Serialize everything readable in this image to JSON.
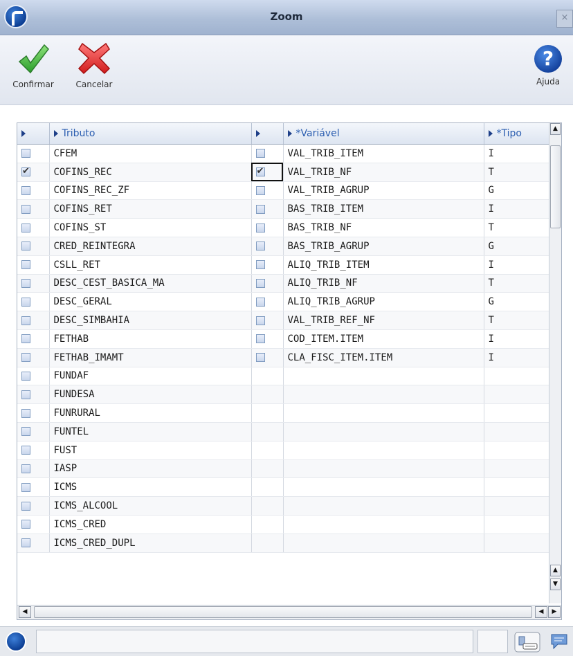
{
  "window": {
    "title": "Zoom",
    "close_glyph": "×"
  },
  "toolbar": {
    "confirm_label": "Confirmar",
    "cancel_label": "Cancelar",
    "help_label": "Ajuda",
    "help_glyph": "?"
  },
  "grid": {
    "headers": {
      "tributo": "Tributo",
      "variavel": "*Variável",
      "tipo": "*Tipo"
    },
    "focused_row_index": 1,
    "rows": [
      {
        "tributo": "CFEM",
        "t_checked": false,
        "variavel": "VAL_TRIB_ITEM",
        "v_checked": false,
        "tipo": "I"
      },
      {
        "tributo": "COFINS_REC",
        "t_checked": true,
        "variavel": "VAL_TRIB_NF",
        "v_checked": true,
        "tipo": "T"
      },
      {
        "tributo": "COFINS_REC_ZF",
        "t_checked": false,
        "variavel": "VAL_TRIB_AGRUP",
        "v_checked": false,
        "tipo": "G"
      },
      {
        "tributo": "COFINS_RET",
        "t_checked": false,
        "variavel": "BAS_TRIB_ITEM",
        "v_checked": false,
        "tipo": "I"
      },
      {
        "tributo": "COFINS_ST",
        "t_checked": false,
        "variavel": "BAS_TRIB_NF",
        "v_checked": false,
        "tipo": "T"
      },
      {
        "tributo": "CRED_REINTEGRA",
        "t_checked": false,
        "variavel": "BAS_TRIB_AGRUP",
        "v_checked": false,
        "tipo": "G"
      },
      {
        "tributo": "CSLL_RET",
        "t_checked": false,
        "variavel": "ALIQ_TRIB_ITEM",
        "v_checked": false,
        "tipo": "I"
      },
      {
        "tributo": "DESC_CEST_BASICA_MA",
        "t_checked": false,
        "variavel": "ALIQ_TRIB_NF",
        "v_checked": false,
        "tipo": "T"
      },
      {
        "tributo": "DESC_GERAL",
        "t_checked": false,
        "variavel": "ALIQ_TRIB_AGRUP",
        "v_checked": false,
        "tipo": "G"
      },
      {
        "tributo": "DESC_SIMBAHIA",
        "t_checked": false,
        "variavel": "VAL_TRIB_REF_NF",
        "v_checked": false,
        "tipo": "T"
      },
      {
        "tributo": "FETHAB",
        "t_checked": false,
        "variavel": "COD_ITEM.ITEM",
        "v_checked": false,
        "tipo": "I"
      },
      {
        "tributo": "FETHAB_IMAMT",
        "t_checked": false,
        "variavel": "CLA_FISC_ITEM.ITEM",
        "v_checked": false,
        "tipo": "I"
      },
      {
        "tributo": "FUNDAF",
        "t_checked": false
      },
      {
        "tributo": "FUNDESA",
        "t_checked": false
      },
      {
        "tributo": "FUNRURAL",
        "t_checked": false
      },
      {
        "tributo": "FUNTEL",
        "t_checked": false
      },
      {
        "tributo": "FUST",
        "t_checked": false
      },
      {
        "tributo": "IASP",
        "t_checked": false
      },
      {
        "tributo": "ICMS",
        "t_checked": false
      },
      {
        "tributo": "ICMS_ALCOOL",
        "t_checked": false
      },
      {
        "tributo": "ICMS_CRED",
        "t_checked": false
      },
      {
        "tributo": "ICMS_CRED_DUPL",
        "t_checked": false
      }
    ]
  },
  "icons": {
    "app": "totvs-logo-icon",
    "confirm": "checkmark-icon",
    "cancel": "x-icon",
    "help": "help-icon",
    "keyboard": "keyboard-icon",
    "chat": "chat-icon"
  }
}
